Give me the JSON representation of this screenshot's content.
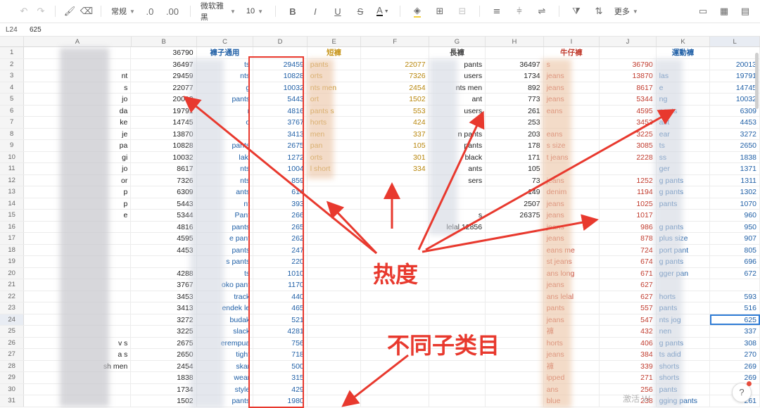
{
  "toolbar": {
    "format_label": "常规",
    "decrease_decimal": ".0",
    "increase_decimal": ".00",
    "font_name": "微软雅黑",
    "font_size": "10",
    "bold": "B",
    "italic": "I",
    "underline": "U",
    "strike": "S",
    "font_color": "A",
    "more_label": "更多"
  },
  "formula_bar": {
    "cell_ref": "L24",
    "value": "625"
  },
  "columns": [
    "A",
    "B",
    "C",
    "D",
    "E",
    "F",
    "G",
    "H",
    "I",
    "J",
    "K",
    "L"
  ],
  "headers": {
    "c": "褲子通用",
    "e": "短褲",
    "g": "長褲",
    "i": "牛仔褲",
    "k": "運動褲"
  },
  "rows": [
    {
      "n": "1",
      "a": "",
      "b": "36790",
      "c": "",
      "d": "",
      "e": "",
      "f": "",
      "g": "",
      "h": "",
      "i": "",
      "j": "",
      "k": "",
      "l": ""
    },
    {
      "n": "2",
      "a": "",
      "b": "36497",
      "c": "ts",
      "d": "29459",
      "e": "pants",
      "f": "22077",
      "g": "pants",
      "h": "36497",
      "i": "s",
      "j": "36790",
      "k": "",
      "l": "20013"
    },
    {
      "n": "3",
      "a": "nt",
      "b": "29459",
      "c": "nts",
      "d": "10828",
      "e": "orts",
      "f": "7326",
      "g": "users",
      "h": "1734",
      "i": "jeans",
      "j": "13870",
      "k": "las",
      "l": "19791"
    },
    {
      "n": "4",
      "a": "s",
      "b": "22077",
      "c": "g",
      "d": "10032",
      "e": "nts men",
      "f": "2454",
      "g": "nts men",
      "h": "892",
      "i": "jeans",
      "j": "8617",
      "k": "e",
      "l": "14745"
    },
    {
      "n": "5",
      "a": "jo",
      "b": "20013",
      "c": "pants",
      "d": "5443",
      "e": "ort",
      "f": "1502",
      "g": "ant",
      "h": "773",
      "i": "jeans",
      "j": "5344",
      "k": "ng",
      "l": "10032"
    },
    {
      "n": "6",
      "a": "da",
      "b": "19791",
      "c": "r",
      "d": "4816",
      "e": "pants s",
      "f": "553",
      "g": "users",
      "h": "261",
      "i": "eans",
      "j": "4595",
      "k": "pants",
      "l": "6309"
    },
    {
      "n": "7",
      "a": "ke",
      "b": "14745",
      "c": "o",
      "d": "3767",
      "e": "horts",
      "f": "424",
      "g": "",
      "h": "253",
      "i": "",
      "j": "3453",
      "k": "ant",
      "l": "4453"
    },
    {
      "n": "8",
      "a": "je",
      "b": "13870",
      "c": "",
      "d": "3413",
      "e": "men",
      "f": "337",
      "g": "n pants",
      "h": "203",
      "i": "eans",
      "j": "3225",
      "k": "ear",
      "l": "3272"
    },
    {
      "n": "9",
      "a": "pa",
      "b": "10828",
      "c": "pants",
      "d": "2675",
      "e": "pan",
      "f": "105",
      "g": "pants",
      "h": "178",
      "i": "s size",
      "j": "3085",
      "k": "ts",
      "l": "2650"
    },
    {
      "n": "10",
      "a": "gi",
      "b": "10032",
      "c": "laki",
      "d": "1272",
      "e": "orts",
      "f": "301",
      "g": "black",
      "h": "171",
      "i": "t jeans",
      "j": "2228",
      "k": "ss",
      "l": "1838"
    },
    {
      "n": "11",
      "a": "jo",
      "b": "8617",
      "c": "nts",
      "d": "1004",
      "e": "l short",
      "f": "334",
      "g": "ants",
      "h": "105",
      "i": "",
      "j": "",
      "k": "ger",
      "l": "1371"
    },
    {
      "n": "12",
      "a": "or",
      "b": "7326",
      "c": "nts",
      "d": "859",
      "e": "",
      "f": "",
      "g": "sers",
      "h": "73",
      "i": "jeans",
      "j": "1252",
      "k": "g pants",
      "l": "1311"
    },
    {
      "n": "13",
      "a": "p",
      "b": "6309",
      "c": "ants",
      "d": "614",
      "e": "",
      "f": "",
      "g": "",
      "h": "149",
      "i": "denim",
      "j": "1194",
      "k": "g pants",
      "l": "1302"
    },
    {
      "n": "14",
      "a": "p",
      "b": "5443",
      "c": "nt",
      "d": "393",
      "e": "",
      "f": "",
      "g": "",
      "h": "2507",
      "i": "jeans",
      "j": "1025",
      "k": "pants",
      "l": "1070"
    },
    {
      "n": "15",
      "a": "e",
      "b": "5344",
      "c": "Pant",
      "d": "266",
      "e": "",
      "f": "",
      "g": "s",
      "h": "26375",
      "i": "jeans",
      "j": "1017",
      "k": "",
      "l": "960"
    },
    {
      "n": "16",
      "a": "",
      "b": "4816",
      "c": "pants",
      "d": "265",
      "e": "",
      "f": "",
      "g": "lelal 12856",
      "h": "",
      "i": "jeans",
      "j": "986",
      "k": "g pants",
      "l": "950"
    },
    {
      "n": "17",
      "a": "",
      "b": "4595",
      "c": "e pant",
      "d": "262",
      "e": "",
      "f": "",
      "g": "",
      "h": "",
      "i": "jeans",
      "j": "878",
      "k": "plus size",
      "l": "907"
    },
    {
      "n": "18",
      "a": "",
      "b": "4453",
      "c": "pants",
      "d": "247",
      "e": "",
      "f": "",
      "g": "",
      "h": "",
      "i": "eans me",
      "j": "724",
      "k": "port pant",
      "l": "805"
    },
    {
      "n": "19",
      "a": "",
      "b": "",
      "c": "s pants",
      "d": "220",
      "e": "",
      "f": "",
      "g": "",
      "h": "",
      "i": "st jeans",
      "j": "674",
      "k": "g pants",
      "l": "696"
    },
    {
      "n": "20",
      "a": "",
      "b": "4288",
      "c": "ts",
      "d": "1010",
      "e": "",
      "f": "",
      "g": "",
      "h": "",
      "i": "ans long",
      "j": "671",
      "k": "gger pan",
      "l": "672"
    },
    {
      "n": "21",
      "a": "",
      "b": "3767",
      "c": "oko pant",
      "d": "1170",
      "e": "",
      "f": "",
      "g": "",
      "h": "",
      "i": "jeans",
      "j": "627",
      "k": "",
      "l": ""
    },
    {
      "n": "22",
      "a": "",
      "b": "3453",
      "c": "track",
      "d": "440",
      "e": "",
      "f": "",
      "g": "",
      "h": "",
      "i": "ans lelal",
      "j": "627",
      "k": "horts",
      "l": "593"
    },
    {
      "n": "23",
      "a": "",
      "b": "3413",
      "c": "endek le",
      "d": "465",
      "e": "",
      "f": "",
      "g": "",
      "h": "",
      "i": "pants",
      "j": "557",
      "k": "pants",
      "l": "516"
    },
    {
      "n": "24",
      "a": "",
      "b": "3272",
      "c": "budak",
      "d": "521",
      "e": "",
      "f": "",
      "g": "",
      "h": "",
      "i": "jeans",
      "j": "547",
      "k": "nts jog",
      "l": "625"
    },
    {
      "n": "25",
      "a": "",
      "b": "3225",
      "c": "slack",
      "d": "4281",
      "e": "",
      "f": "",
      "g": "",
      "h": "",
      "i": "褲",
      "j": "432",
      "k": "nen",
      "l": "337"
    },
    {
      "n": "26",
      "a": "v s",
      "b": "2675",
      "c": "erempua",
      "d": "756",
      "e": "",
      "f": "",
      "g": "",
      "h": "",
      "i": "horts",
      "j": "406",
      "k": "g pants",
      "l": "308"
    },
    {
      "n": "27",
      "a": "a s",
      "b": "2650",
      "c": "tight",
      "d": "718",
      "e": "",
      "f": "",
      "g": "",
      "h": "",
      "i": "jeans",
      "j": "384",
      "k": "ts adid",
      "l": "270"
    },
    {
      "n": "28",
      "a": "sh men",
      "b": "2454",
      "c": "skar",
      "d": "500",
      "e": "",
      "f": "",
      "g": "",
      "h": "",
      "i": "褲",
      "j": "339",
      "k": "shorts",
      "l": "269"
    },
    {
      "n": "29",
      "a": "",
      "b": "1838",
      "c": "wear",
      "d": "315",
      "e": "",
      "f": "",
      "g": "",
      "h": "",
      "i": "ipped",
      "j": "271",
      "k": "shorts",
      "l": "269"
    },
    {
      "n": "30",
      "a": "",
      "b": "1734",
      "c": "style",
      "d": "429",
      "e": "",
      "f": "",
      "g": "",
      "h": "",
      "i": "ans",
      "j": "256",
      "k": "pants",
      "l": ""
    },
    {
      "n": "31",
      "a": "",
      "b": "1502",
      "c": "pants",
      "d": "1980",
      "e": "",
      "f": "",
      "g": "",
      "h": "",
      "i": "blue",
      "j": "238",
      "k": "gging pants",
      "l": "261"
    }
  ],
  "annotations": {
    "heat": "热度",
    "subcategories": "不同子类目"
  },
  "watermark": "激活 W",
  "help": "?"
}
